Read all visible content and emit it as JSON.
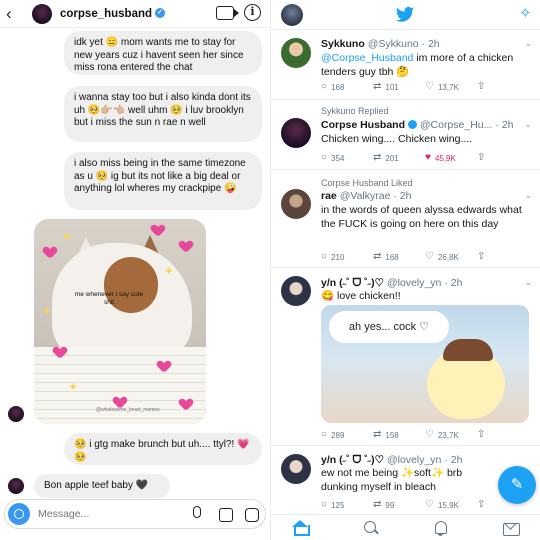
{
  "dm": {
    "back_icon": "‹",
    "username": "corpse_husband",
    "verified_icon": "✓",
    "info_icon": "i",
    "messages": [
      {
        "text": "idk yet 😑 mom wants me to stay for new years cuz i havent seen her since miss rona entered the chat"
      },
      {
        "text": "i wanna stay too but i also kinda dont its uh 🥺👉🏼👈🏼 well uhm 🥺 i luv brooklyn but i miss the sun n rae n well"
      },
      {
        "text": "i also miss being in the same timezone as u 🥺 ig but its not like a big deal or anything lol wheres my crackpipe 🤪"
      },
      {
        "text": "🥺 i gtg make brunch but uh.... ttyl?! 💗🥺"
      },
      {
        "text": "Bon apple teef baby 🖤"
      }
    ],
    "photo": {
      "caption": "me whenever i say cute shit",
      "credit": "@wholesome_heart_memes"
    },
    "composer": {
      "placeholder": "Message..."
    }
  },
  "twitter": {
    "logo_icon": "bird-icon",
    "compose_top_icon": "✧",
    "tweets": [
      {
        "context": "",
        "name": "Sykkuno",
        "handle": "@Sykkuno",
        "time": "· 2h",
        "mention": "@Corpse_Husband",
        "body": " im more of a chicken tenders guy tbh 🤔",
        "reply": "168",
        "retweet": "101",
        "like": "13,7K"
      },
      {
        "context": "Sykkuno Replied",
        "name": "Corpse Husband",
        "handle": "@Corpse_Hu...",
        "time": "· 2h",
        "mention": "",
        "body": "Chicken wing.... Chicken wing....",
        "reply": "354",
        "retweet": "201",
        "like": "45,9K"
      },
      {
        "context": "Corpse Husband Liked",
        "name": "rae",
        "handle": "@Valkyrae",
        "time": "· 2h",
        "mention": "",
        "body": "in the words of queen alyssa edwards what the FUCK is going on here on this day",
        "reply": "210",
        "retweet": "168",
        "like": "26,8K"
      },
      {
        "context": "",
        "name": "y/n (˶˚ ᗜ ˚˶)♡",
        "handle": "@lovely_yn",
        "time": "· 2h",
        "mention": "",
        "body": "😋 love chicken!!",
        "image_text": "ah yes... cock ♡",
        "reply": "289",
        "retweet": "158",
        "like": "23,7K"
      },
      {
        "context": "",
        "name": "y/n (˶˚ ᗜ ˚˶)♡",
        "handle": "@lovely_yn",
        "time": "· 2h",
        "mention": "",
        "body": "ew not me being ✨soft✨ brb dunking myself in bleach",
        "reply": "125",
        "retweet": "99",
        "like": "15,9K"
      }
    ],
    "fab_icon": "✎",
    "colors": {
      "accent": "#1da1f2",
      "like": "#e0245e",
      "verified": "#3897f0"
    }
  }
}
